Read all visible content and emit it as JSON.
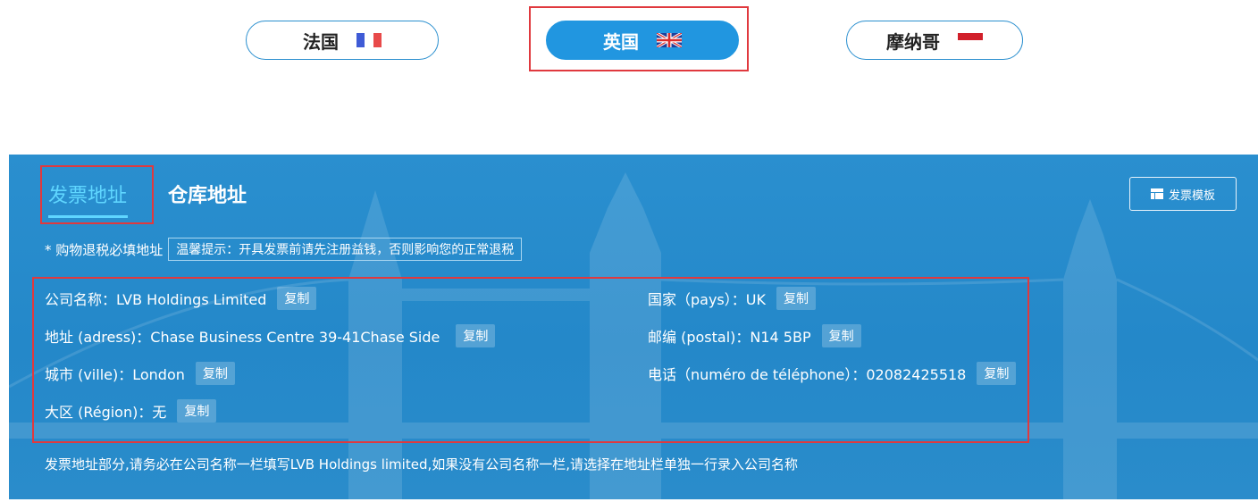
{
  "countries": [
    {
      "label": "法国"
    },
    {
      "label": "英国"
    },
    {
      "label": "摩纳哥"
    }
  ],
  "active_country": "英国",
  "colors": {
    "accent": "#2196e0",
    "highlight": "#e0393e",
    "active_tab": "#5fd6ff"
  },
  "panel": {
    "tabs": [
      {
        "label": "发票地址"
      },
      {
        "label": "仓库地址"
      }
    ],
    "template_button": "发票模板",
    "required_label": "* 购物退税必填地址",
    "tip": "温馨提示：开具发票前请先注册益钱，否则影响您的正常退税",
    "copy_label": "复制",
    "fields": {
      "company": "公司名称：LVB Holdings Limited",
      "address": "地址 (adress)：Chase Business Centre 39-41Chase Side",
      "city": "城市 (ville)：London",
      "region": "大区 (Région)：无",
      "country": "国家（pays）：UK",
      "postal": "邮编 (postal)：N14 5BP",
      "phone": "电话（numéro de téléphone）：02082425518"
    },
    "note": "发票地址部分,请务必在公司名称一栏填写LVB Holdings limited,如果没有公司名称一栏,请选择在地址栏单独一行录入公司名称"
  }
}
